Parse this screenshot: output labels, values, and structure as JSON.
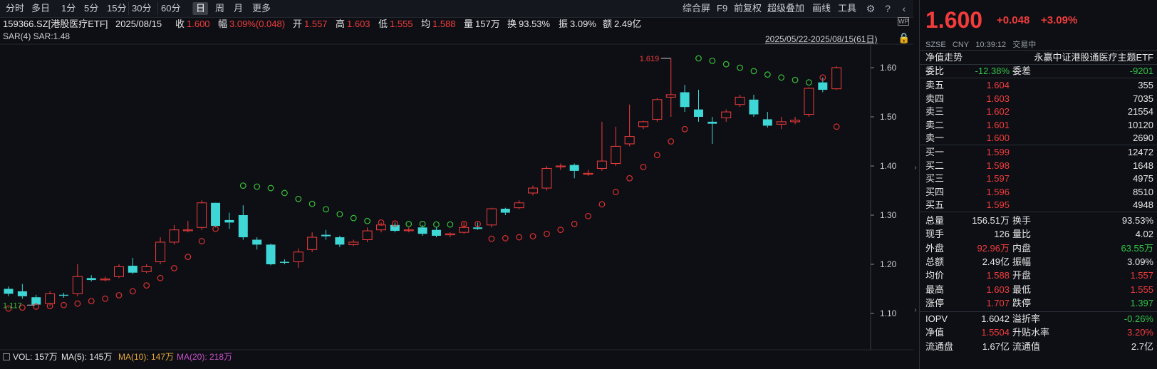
{
  "toolbar": {
    "left": [
      "分时",
      "多日",
      "1分",
      "5分",
      "15分",
      "30分",
      "60分",
      "日",
      "周",
      "月",
      "更多"
    ],
    "active": "日",
    "right": [
      "综合屏",
      "F9",
      "前复权",
      "超级叠加",
      "画线",
      "工具"
    ]
  },
  "info": {
    "code": "159366.SZ[港股医疗ETF]",
    "date": "2025/08/15",
    "close_label": "收",
    "close": "1.600",
    "amp_label": "幅",
    "amp": "3.09%(0.048)",
    "open_label": "开",
    "open": "1.557",
    "high_label": "高",
    "high": "1.603",
    "low_label": "低",
    "low": "1.555",
    "avg_label": "均",
    "avg": "1.588",
    "vol_label": "量",
    "vol": "157万",
    "turn_label": "换",
    "turn": "93.53%",
    "swing_label": "振",
    "swing": "3.09%",
    "amount_label": "额",
    "amount": "2.49亿"
  },
  "sar_label": "SAR(4)  SAR:1.48",
  "range": "2025/05/22-2025/08/15(61日)",
  "statusbar": {
    "vol": "VOL: 157万",
    "ma5": "MA(5): 145万",
    "ma10": "MA(10): 147万",
    "ma20": "MA(20): 218万"
  },
  "quote": {
    "price": "1.600",
    "change": "+0.048",
    "change_pct": "+3.09%",
    "market": "SZSE",
    "currency": "CNY",
    "time": "10:39:12",
    "status": "交易中",
    "nav_trend_label": "净值走势",
    "fund_name": "永赢中证港股通医疗主题ETF",
    "weibi_label": "委比",
    "weibi": "-12.38%",
    "weicha_label": "委差",
    "weicha": "-9201",
    "asks": [
      {
        "label": "卖五",
        "price": "1.604",
        "vol": "355"
      },
      {
        "label": "卖四",
        "price": "1.603",
        "vol": "7035"
      },
      {
        "label": "卖三",
        "price": "1.602",
        "vol": "21554"
      },
      {
        "label": "卖二",
        "price": "1.601",
        "vol": "10120"
      },
      {
        "label": "卖一",
        "price": "1.600",
        "vol": "2690"
      }
    ],
    "bids": [
      {
        "label": "买一",
        "price": "1.599",
        "vol": "12472"
      },
      {
        "label": "买二",
        "price": "1.598",
        "vol": "1648"
      },
      {
        "label": "买三",
        "price": "1.597",
        "vol": "4975"
      },
      {
        "label": "买四",
        "price": "1.596",
        "vol": "8510"
      },
      {
        "label": "买五",
        "price": "1.595",
        "vol": "4948"
      }
    ],
    "stats": [
      {
        "l1": "总量",
        "v1": "156.51万",
        "l2": "换手",
        "v2": "93.53%",
        "c1": "white",
        "c2": "white"
      },
      {
        "l1": "现手",
        "v1": "126",
        "l2": "量比",
        "v2": "4.02",
        "c1": "white",
        "c2": "white"
      },
      {
        "l1": "外盘",
        "v1": "92.96万",
        "l2": "内盘",
        "v2": "63.55万",
        "c1": "red",
        "c2": "green"
      },
      {
        "l1": "总额",
        "v1": "2.49亿",
        "l2": "振幅",
        "v2": "3.09%",
        "c1": "white",
        "c2": "white"
      },
      {
        "l1": "均价",
        "v1": "1.588",
        "l2": "开盘",
        "v2": "1.557",
        "c1": "red",
        "c2": "red"
      },
      {
        "l1": "最高",
        "v1": "1.603",
        "l2": "最低",
        "v2": "1.555",
        "c1": "red",
        "c2": "red"
      },
      {
        "l1": "涨停",
        "v1": "1.707",
        "l2": "跌停",
        "v2": "1.397",
        "c1": "red",
        "c2": "green"
      }
    ],
    "stats2": [
      {
        "l1": "IOPV",
        "v1": "1.6042",
        "l2": "溢折率",
        "v2": "-0.26%",
        "c1": "white",
        "c2": "green"
      },
      {
        "l1": "净值",
        "v1": "1.5504",
        "l2": "升贴水率",
        "v2": "3.20%",
        "c1": "red",
        "c2": "red"
      },
      {
        "l1": "流通盘",
        "v1": "1.67亿",
        "l2": "流通值",
        "v2": "2.7亿",
        "c1": "white",
        "c2": "white"
      }
    ]
  },
  "chart_data": {
    "type": "candlestick",
    "y_ticks": [
      "1.60",
      "1.50",
      "1.40",
      "1.30",
      "1.20",
      "1.10"
    ],
    "ylim": [
      1.08,
      1.645
    ],
    "max_label": "1.619",
    "min_label": "1.117",
    "up_color": "#f23c3c",
    "down_color": "#3fd6d6",
    "candles": [
      [
        1.15,
        1.14,
        1.155,
        1.135
      ],
      [
        1.145,
        1.135,
        1.16,
        1.13
      ],
      [
        1.133,
        1.118,
        1.138,
        1.117
      ],
      [
        1.12,
        1.14,
        1.145,
        1.115
      ],
      [
        1.138,
        1.136,
        1.142,
        1.132
      ],
      [
        1.14,
        1.175,
        1.2,
        1.135
      ],
      [
        1.172,
        1.168,
        1.178,
        1.165
      ],
      [
        1.17,
        1.17,
        1.175,
        1.165
      ],
      [
        1.175,
        1.195,
        1.2,
        1.172
      ],
      [
        1.197,
        1.183,
        1.213,
        1.18
      ],
      [
        1.185,
        1.195,
        1.2,
        1.182
      ],
      [
        1.205,
        1.245,
        1.255,
        1.2
      ],
      [
        1.245,
        1.27,
        1.28,
        1.24
      ],
      [
        1.27,
        1.27,
        1.288,
        1.265
      ],
      [
        1.275,
        1.325,
        1.33,
        1.27
      ],
      [
        1.325,
        1.278,
        1.325,
        1.275
      ],
      [
        1.29,
        1.285,
        1.305,
        1.272
      ],
      [
        1.3,
        1.255,
        1.32,
        1.25
      ],
      [
        1.25,
        1.24,
        1.255,
        1.23
      ],
      [
        1.24,
        1.2,
        1.242,
        1.198
      ],
      [
        1.205,
        1.203,
        1.21,
        1.2
      ],
      [
        1.205,
        1.225,
        1.232,
        1.193
      ],
      [
        1.23,
        1.255,
        1.265,
        1.225
      ],
      [
        1.26,
        1.257,
        1.27,
        1.25
      ],
      [
        1.255,
        1.24,
        1.258,
        1.235
      ],
      [
        1.24,
        1.245,
        1.25,
        1.237
      ],
      [
        1.25,
        1.268,
        1.275,
        1.245
      ],
      [
        1.27,
        1.28,
        1.285,
        1.265
      ],
      [
        1.28,
        1.268,
        1.285,
        1.265
      ],
      [
        1.27,
        1.27,
        1.275,
        1.265
      ],
      [
        1.275,
        1.262,
        1.28,
        1.258
      ],
      [
        1.27,
        1.258,
        1.275,
        1.255
      ],
      [
        1.26,
        1.262,
        1.265,
        1.255
      ],
      [
        1.265,
        1.275,
        1.285,
        1.262
      ],
      [
        1.275,
        1.272,
        1.285,
        1.27
      ],
      [
        1.28,
        1.313,
        1.315,
        1.275
      ],
      [
        1.313,
        1.305,
        1.315,
        1.3
      ],
      [
        1.315,
        1.325,
        1.33,
        1.312
      ],
      [
        1.345,
        1.355,
        1.36,
        1.34
      ],
      [
        1.355,
        1.395,
        1.4,
        1.35
      ],
      [
        1.4,
        1.4,
        1.405,
        1.392
      ],
      [
        1.402,
        1.39,
        1.405,
        1.375
      ],
      [
        1.385,
        1.385,
        1.392,
        1.38
      ],
      [
        1.395,
        1.41,
        1.49,
        1.39
      ],
      [
        1.405,
        1.44,
        1.48,
        1.4
      ],
      [
        1.445,
        1.46,
        1.525,
        1.44
      ],
      [
        1.48,
        1.49,
        1.492,
        1.475
      ],
      [
        1.495,
        1.535,
        1.538,
        1.49
      ],
      [
        1.54,
        1.545,
        1.619,
        1.5
      ],
      [
        1.55,
        1.52,
        1.565,
        1.51
      ],
      [
        1.515,
        1.5,
        1.555,
        1.49
      ],
      [
        1.49,
        1.486,
        1.5,
        1.445
      ],
      [
        1.498,
        1.51,
        1.515,
        1.49
      ],
      [
        1.525,
        1.54,
        1.545,
        1.52
      ],
      [
        1.535,
        1.505,
        1.545,
        1.5
      ],
      [
        1.495,
        1.482,
        1.51,
        1.478
      ],
      [
        1.485,
        1.49,
        1.5,
        1.475
      ],
      [
        1.49,
        1.493,
        1.5,
        1.485
      ],
      [
        1.505,
        1.558,
        1.56,
        1.5
      ],
      [
        1.57,
        1.555,
        1.58,
        1.55
      ],
      [
        1.557,
        1.6,
        1.603,
        1.555
      ]
    ],
    "sar": [
      [
        0,
        1.11
      ],
      [
        1,
        1.112
      ],
      [
        2,
        1.114
      ],
      [
        3,
        1.115
      ],
      [
        4,
        1.117
      ],
      [
        5,
        1.12
      ],
      [
        6,
        1.125
      ],
      [
        7,
        1.13
      ],
      [
        8,
        1.137
      ],
      [
        9,
        1.145
      ],
      [
        10,
        1.157
      ],
      [
        11,
        1.172
      ],
      [
        12,
        1.192
      ],
      [
        13,
        1.215
      ],
      [
        14,
        1.247
      ],
      [
        15,
        1.272
      ],
      [
        17,
        1.36
      ],
      [
        18,
        1.358
      ],
      [
        19,
        1.355
      ],
      [
        20,
        1.345
      ],
      [
        21,
        1.333
      ],
      [
        22,
        1.323
      ],
      [
        23,
        1.312
      ],
      [
        24,
        1.302
      ],
      [
        25,
        1.294
      ],
      [
        26,
        1.288
      ],
      [
        27,
        1.285
      ],
      [
        28,
        1.283
      ],
      [
        29,
        1.282
      ],
      [
        30,
        1.282
      ],
      [
        31,
        1.281
      ],
      [
        32,
        1.281
      ],
      [
        33,
        1.282
      ],
      [
        34,
        1.282
      ],
      [
        35,
        1.252
      ],
      [
        36,
        1.253
      ],
      [
        37,
        1.255
      ],
      [
        38,
        1.257
      ],
      [
        39,
        1.262
      ],
      [
        40,
        1.27
      ],
      [
        41,
        1.282
      ],
      [
        42,
        1.298
      ],
      [
        43,
        1.322
      ],
      [
        44,
        1.347
      ],
      [
        45,
        1.375
      ],
      [
        46,
        1.398
      ],
      [
        47,
        1.422
      ],
      [
        48,
        1.45
      ],
      [
        49,
        1.475
      ],
      [
        50,
        1.619
      ],
      [
        51,
        1.614
      ],
      [
        52,
        1.607
      ],
      [
        53,
        1.6
      ],
      [
        54,
        1.593
      ],
      [
        55,
        1.586
      ],
      [
        56,
        1.58
      ],
      [
        57,
        1.575
      ],
      [
        58,
        1.57
      ],
      [
        59,
        1.58
      ],
      [
        60,
        1.48
      ]
    ]
  }
}
